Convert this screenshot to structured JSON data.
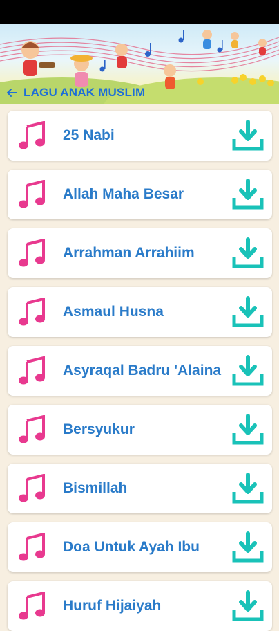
{
  "header": {
    "title": "LAGU ANAK MUSLIM",
    "back_icon": "arrow-left-icon"
  },
  "songs": [
    {
      "title": "25 Nabi"
    },
    {
      "title": "Allah Maha Besar"
    },
    {
      "title": "Arrahman Arrahiim"
    },
    {
      "title": "Asmaul Husna"
    },
    {
      "title": "Asyraqal Badru 'Alaina"
    },
    {
      "title": "Bersyukur"
    },
    {
      "title": "Bismillah"
    },
    {
      "title": "Doa Untuk Ayah Ibu"
    },
    {
      "title": "Huruf Hijaiyah"
    }
  ],
  "icons": {
    "song_icon": "music-note-icon",
    "action_icon": "download-icon"
  },
  "colors": {
    "title": "#1e6fd6",
    "song_text": "#2a7bc9",
    "music_icon": "#e8398f",
    "download_icon": "#19c2b8",
    "background": "#f7efe1"
  }
}
